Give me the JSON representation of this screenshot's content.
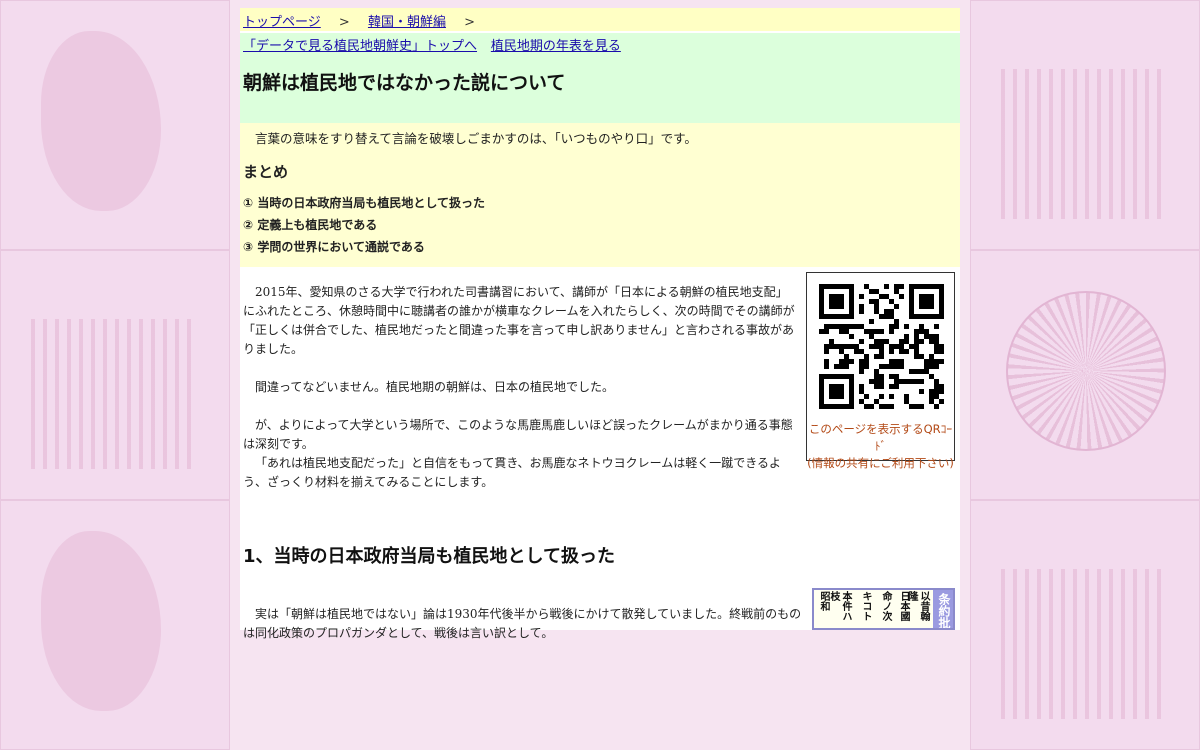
{
  "breadcrumb": {
    "top": "トップページ",
    "sep1": ">",
    "category": "韓国・朝鮮編",
    "sep2": ">"
  },
  "header": {
    "link_top": "「データで見る植民地朝鮮史」トップへ",
    "link_timeline": "植民地期の年表を見る",
    "title": "朝鮮は植民地ではなかった説について"
  },
  "summary": {
    "lead": "言葉の意味をすり替えて言論を破壊しごまかすのは、「いつものやり口」です。",
    "heading": "まとめ",
    "points": [
      "① 当時の日本政府当局も植民地として扱った",
      "② 定義上も植民地である",
      "③ 学問の世界において通説である"
    ]
  },
  "article": {
    "p1": "2015年、愛知県のさる大学で行われた司書講習において、講師が「日本による朝鮮の植民地支配」にふれたところ、休憩時間中に聴講者の誰かが横車なクレームを入れたらしく、次の時間でその講師が「正しくは併合でした、植民地だったと間違った事を言って申し訳ありません」と言わされる事故がありました。",
    "p2": "間違ってなどいません。植民地期の朝鮮は、日本の植民地でした。",
    "p3": "が、よりによって大学という場所で、このような馬鹿馬鹿しいほど誤ったクレームがまかり通る事態は深刻です。",
    "p4": "「あれは植民地支配だった」と自信をもって貫き、お馬鹿なネトウヨクレームは軽く一蹴できるよう、ざっくり材料を揃えてみることにします。",
    "section1_title": "1、当時の日本政府当局も植民地として扱った",
    "p5": "実は「朝鮮は植民地ではない」論は1930年代後半から戦後にかけて散発していました。終戦前のものは同化政策のプロパガンダとして、戦後は言い訳として。"
  },
  "qr": {
    "caption_line1": "このページを表示するQRｺｰﾄﾞ",
    "caption_line2": "(情報の共有にご利用下さい)"
  },
  "treaty_image": {
    "tag": "条約批",
    "col1": "以昔翰隆",
    "col2": "日本國",
    "col3": "命ノ次",
    "col4": "キコト",
    "col5": "本件ハ枝",
    "col6": "昭和"
  },
  "colors": {
    "background": "#f6e4f1",
    "breadcrumb_bg": "#ffffc4",
    "header_bg": "#dcffdc",
    "summary_bg": "#ffffd2",
    "link": "#1a0dab",
    "qr_caption": "#b34a17"
  }
}
